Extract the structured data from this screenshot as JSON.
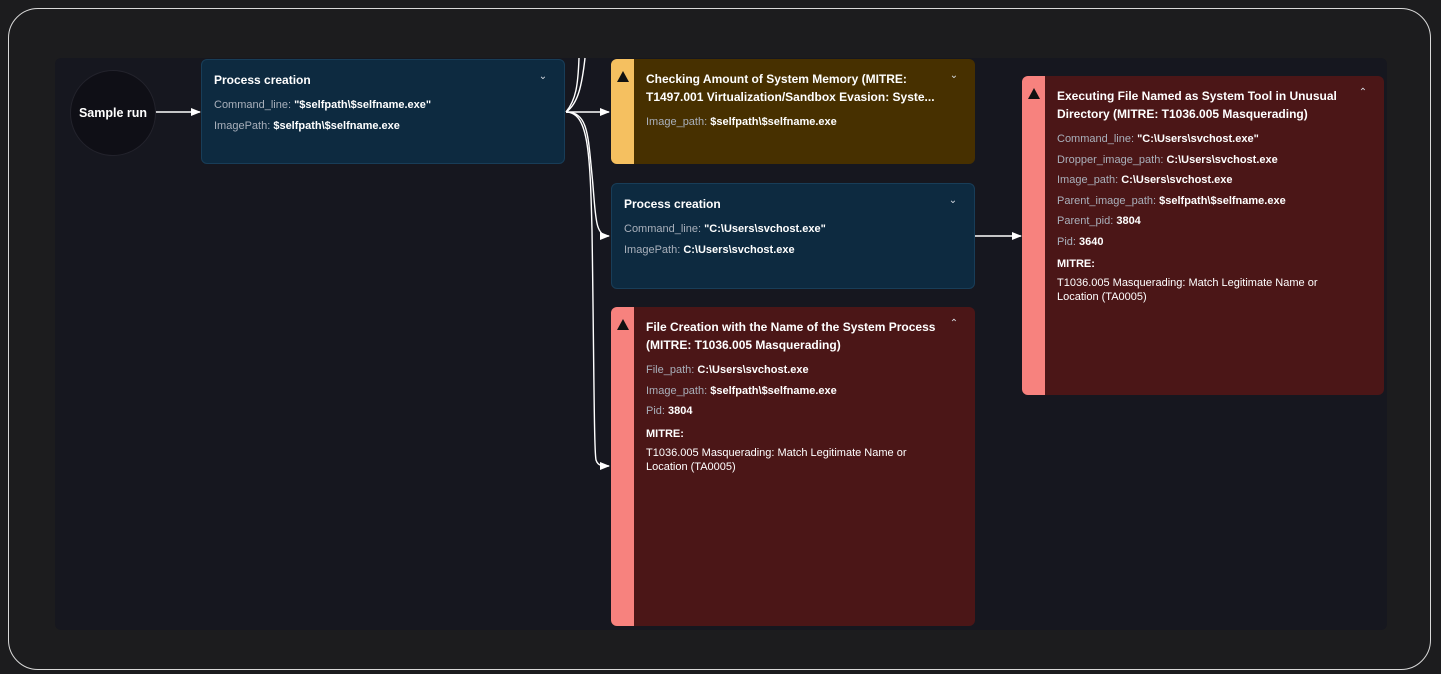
{
  "start_node": {
    "label": "Sample run"
  },
  "nodes": [
    {
      "title": "Process creation",
      "fields": [
        {
          "key": "Command_line: ",
          "value": "\"$selfpath\\$selfname.exe\""
        },
        {
          "key": "ImagePath: ",
          "value": "$selfpath\\$selfname.exe"
        }
      ],
      "expanded": false
    },
    {
      "title": "Checking Amount of System Memory (MITRE: T1497.001 Virtualization/Sandbox Evasion: Syste...",
      "fields": [
        {
          "key": "Image_path: ",
          "value": "$selfpath\\$selfname.exe"
        }
      ],
      "expanded": false,
      "color": "#f5c060"
    },
    {
      "title": "Process creation",
      "fields": [
        {
          "key": "Command_line: ",
          "value": "\"C:\\Users\\svchost.exe\""
        },
        {
          "key": "ImagePath: ",
          "value": "C:\\Users\\svchost.exe"
        }
      ],
      "expanded": false
    },
    {
      "title": "File Creation with the Name of the System Process (MITRE: T1036.005 Masquerading)",
      "fields": [
        {
          "key": "File_path: ",
          "value": "C:\\Users\\svchost.exe"
        },
        {
          "key": "Image_path: ",
          "value": "$selfpath\\$selfname.exe"
        },
        {
          "key": "Pid: ",
          "value": "3804"
        }
      ],
      "mitre_label": "MITRE:",
      "mitre_text": "T1036.005 Masquerading: Match Legitimate Name or Location (TA0005)",
      "expanded": true,
      "color": "#f7827e"
    },
    {
      "title": "Executing File Named as System Tool in Unusual Directory (MITRE: T1036.005 Masquerading)",
      "fields": [
        {
          "key": "Command_line: ",
          "value": "\"C:\\Users\\svchost.exe\""
        },
        {
          "key": "Dropper_image_path: ",
          "value": "C:\\Users\\svchost.exe"
        },
        {
          "key": "Image_path: ",
          "value": "C:\\Users\\svchost.exe"
        },
        {
          "key": "Parent_image_path: ",
          "value": "$selfpath\\$selfname.exe"
        },
        {
          "key": "Parent_pid: ",
          "value": "3804"
        },
        {
          "key": "Pid: ",
          "value": "3640"
        }
      ],
      "mitre_label": "MITRE:",
      "mitre_text": "T1036.005 Masquerading: Match Legitimate Name or Location (TA0005)",
      "expanded": true,
      "color": "#f7827e"
    }
  ],
  "icons": {
    "warning": "warning-icon",
    "collapse": "chevron-up-icon",
    "expand": "chevron-down-icon"
  },
  "colors": {
    "background": "#1c1c1e",
    "canvas": "#16171f",
    "process_card": "#0d2a40",
    "warning_card": "#473000",
    "danger_card": "#4b1617"
  }
}
